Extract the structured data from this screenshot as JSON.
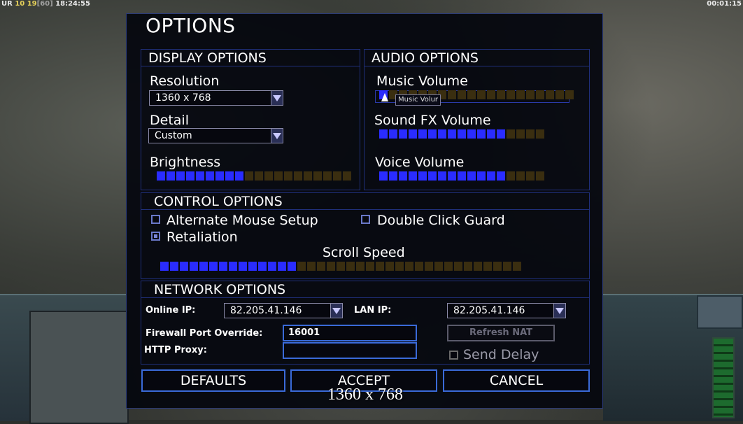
{
  "hud": {
    "top_left_prefix": "UR",
    "top_left_num1": "10",
    "top_left_num2": "19",
    "top_left_bracket": "[60]",
    "top_left_time": "18:24:55",
    "top_right_time": "00:01:15"
  },
  "dialog": {
    "title": "OPTIONS"
  },
  "display": {
    "header": "DISPLAY OPTIONS",
    "resolution_label": "Resolution",
    "resolution_value": "1360 x 768",
    "detail_label": "Detail",
    "detail_value": "Custom",
    "brightness_label": "Brightness",
    "brightness_level": 9,
    "brightness_total": 20
  },
  "audio": {
    "header": "AUDIO OPTIONS",
    "music_label": "Music Volume",
    "music_level": 1,
    "music_total": 20,
    "music_tooltip": "Music Volur",
    "sfx_label": "Sound FX Volume",
    "sfx_level": 13,
    "sfx_total": 17,
    "voice_label": "Voice Volume",
    "voice_level": 13,
    "voice_total": 17
  },
  "control": {
    "header": "CONTROL OPTIONS",
    "alt_mouse_label": "Alternate Mouse Setup",
    "alt_mouse_checked": false,
    "double_click_label": "Double Click Guard",
    "double_click_checked": false,
    "retaliation_label": "Retaliation",
    "retaliation_checked": true,
    "scroll_label": "Scroll Speed",
    "scroll_level": 14,
    "scroll_total": 37
  },
  "network": {
    "header": "NETWORK OPTIONS",
    "online_ip_label": "Online IP:",
    "online_ip_value": "82.205.41.146",
    "lan_ip_label": "LAN IP:",
    "lan_ip_value": "82.205.41.146",
    "firewall_label": "Firewall Port Override:",
    "firewall_value": "16001",
    "http_proxy_label": "HTTP Proxy:",
    "http_proxy_value": "",
    "refresh_nat_label": "Refresh NAT",
    "send_delay_label": "Send Delay",
    "send_delay_checked": false
  },
  "buttons": {
    "defaults": "DEFAULTS",
    "accept": "ACCEPT",
    "cancel": "CANCEL"
  },
  "overlay": {
    "resolution_text": "1360 x 768"
  },
  "colors": {
    "accent": "#2a2cff",
    "border": "#1f2f7a",
    "slider_off": "#3a2e10"
  }
}
